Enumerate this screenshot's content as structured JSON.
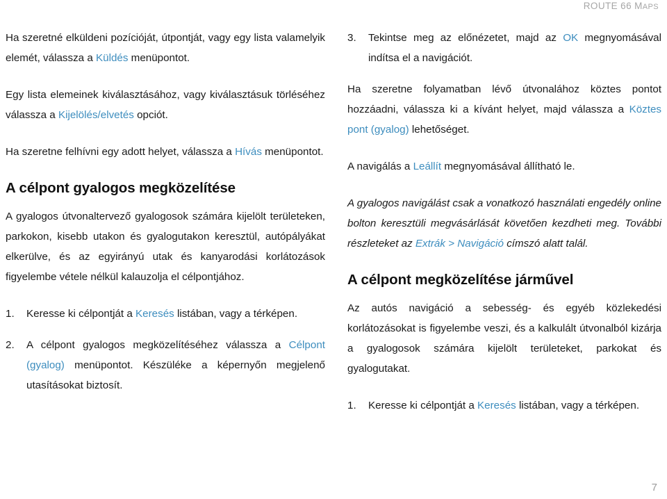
{
  "header": {
    "title_main": "ROUTE 66 M",
    "title_small": "APS"
  },
  "colors": {
    "link": "#3d8dbe",
    "text": "#1a1a1a",
    "header_gray": "#a6a6a6",
    "page_number_gray": "#9b9b9b"
  },
  "left_column": {
    "para_send": {
      "part1": "Ha szeretné elküldeni pozícióját, útpontját, vagy egy lista valamelyik elemét, válassza a ",
      "link": "Küldés",
      "part2": " menüpontot."
    },
    "para_select": {
      "part1": "Egy lista elemeinek kiválasztásához, vagy kiválasztásuk törléséhez válassza a ",
      "link": "Kijelölés/elvetés",
      "part2": " opciót."
    },
    "para_call": {
      "part1": "Ha szeretne felhívni egy adott helyet, válassza a ",
      "link": "Hívás",
      "part2": " menüpontot."
    },
    "heading": "A célpont gyalogos megközelítése",
    "para_pedestrian": "A gyalogos útvonaltervező gyalogosok számára kijelölt területeken, parkokon, kisebb utakon és gyalogutakon keresztül, autópályákat elkerülve, és az egyirányú utak és kanyarodási korlátozások figyelembe vétele nélkül kalauzolja el célpontjához.",
    "steps": [
      {
        "num": "1.",
        "part1": "Keresse ki célpontját a ",
        "link": "Keresés",
        "part2": " listában, vagy a térképen."
      },
      {
        "num": "2.",
        "part1": "A célpont gyalogos megközelítéséhez válassza a ",
        "link": "Célpont (gyalog)",
        "part2": " menüpontot. Készüléke a képernyőn megjelenő utasításokat biztosít."
      }
    ]
  },
  "right_column": {
    "step3": {
      "num": "3.",
      "part1": "Tekintse meg az előnézetet, majd az ",
      "link": "OK",
      "part2": " megnyomásával indítsa el a navigációt."
    },
    "para_via": {
      "part1": "Ha szeretne folyamatban lévő útvonalához köztes pontot hozzáadni, válassza ki a kívánt helyet, majd válassza a ",
      "link": "Köztes pont (gyalog)",
      "part2": " lehetőséget."
    },
    "para_stop": {
      "part1": "A navigálás a ",
      "link": "Leállít",
      "part2": " megnyomásával állítható le."
    },
    "para_license": {
      "part1": "A gyalogos navigálást csak a vonatkozó használati engedély online bolton keresztüli megvásárlását követően kezdheti meg. További részleteket az ",
      "link": "Extrák > Navigáció",
      "part2": " címszó alatt talál."
    },
    "heading": "A célpont megközelítése járművel",
    "para_vehicle": "Az autós navigáció a sebesség- és egyéb közlekedési korlátozásokat is figyelembe veszi, és a kalkulált útvonalból kizárja a gyalogosok számára kijelölt területeket, parkokat és gyalogutakat.",
    "steps": [
      {
        "num": "1.",
        "part1": "Keresse ki célpontját a ",
        "link": "Keresés",
        "part2": " listában, vagy a térképen."
      }
    ]
  },
  "footer": {
    "page_number": "7"
  }
}
